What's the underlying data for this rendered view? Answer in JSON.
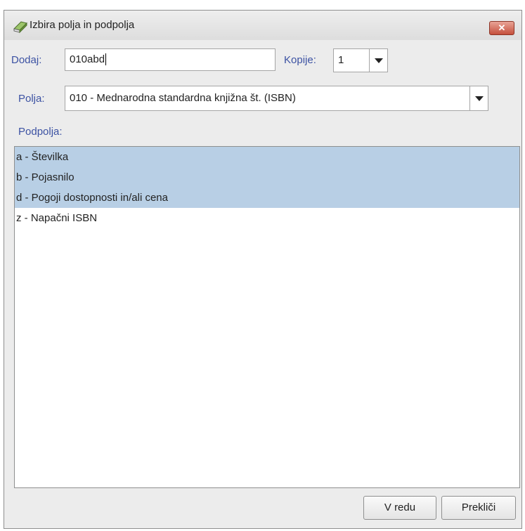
{
  "dialog": {
    "title": "Izbira polja in podpolja",
    "close_icon": "close-icon"
  },
  "dodaj": {
    "label": "Dodaj:",
    "value": "010abd"
  },
  "kopije": {
    "label": "Kopije:",
    "value": "1"
  },
  "polja": {
    "label": "Polja:",
    "value": "010 - Mednarodna standardna knjižna št. (ISBN)"
  },
  "podpolja": {
    "label": "Podpolja:",
    "items": [
      {
        "label": "a - Številka",
        "selected": true
      },
      {
        "label": "b - Pojasnilo",
        "selected": true
      },
      {
        "label": "d - Pogoji dostopnosti in/ali cena",
        "selected": true
      },
      {
        "label": "z - Napačni ISBN",
        "selected": false
      }
    ]
  },
  "buttons": {
    "ok": "V redu",
    "cancel": "Prekliči"
  },
  "colors": {
    "label": "#3c52a3",
    "selection": "#b8cfe5",
    "close": "#c5503c"
  }
}
